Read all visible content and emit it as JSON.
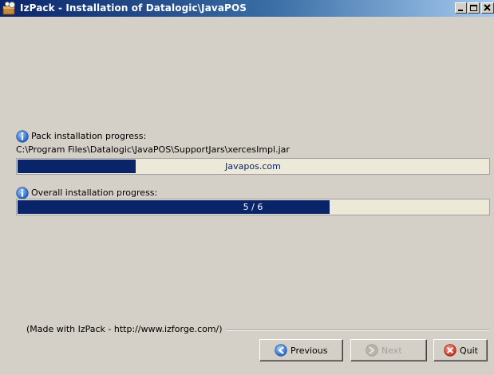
{
  "window": {
    "title": "IzPack - Installation of Datalogic\\JavaPOS",
    "icon": "izpack-app-icon"
  },
  "pack_progress": {
    "label": "Pack installation progress:",
    "current_file": "C:\\Program Files\\Datalogic\\JavaPOS\\SupportJars\\xercesImpl.jar",
    "bar_text": "Javapos.com",
    "fraction": 0.25,
    "icon": "info-icon"
  },
  "overall_progress": {
    "label": "Overall installation progress:",
    "bar_text": "5 / 6",
    "fraction": 0.66,
    "icon": "info-icon"
  },
  "footer": {
    "made_with": "(Made with IzPack - http://www.izforge.com/)"
  },
  "buttons": {
    "previous": {
      "label": "Previous",
      "icon": "previous-arrow-icon",
      "enabled": true
    },
    "next": {
      "label": "Next",
      "icon": "next-arrow-icon",
      "enabled": false
    },
    "quit": {
      "label": "Quit",
      "icon": "quit-x-icon",
      "enabled": true
    }
  },
  "colors": {
    "progress_fill": "#0a246a",
    "title_bar": "#0a246a",
    "window_bg": "#d4d0c8",
    "accent_blue": "#2f6fd6",
    "quit_red": "#d43a2a"
  }
}
